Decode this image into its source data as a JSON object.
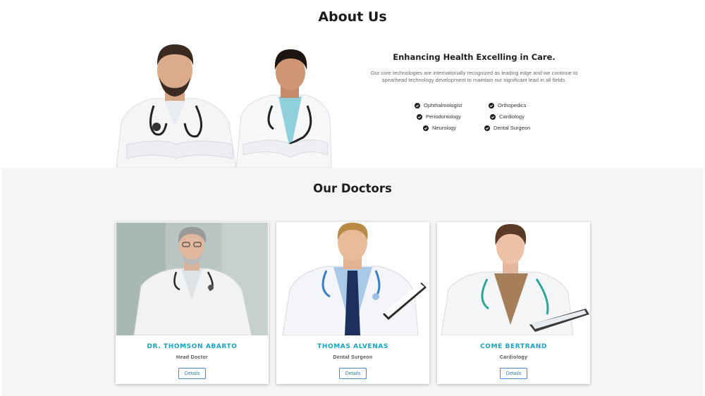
{
  "about": {
    "title": "About Us",
    "subtitle": "Enhancing Health Excelling in Care.",
    "description": "Our core technologies are internationally recognized as leading edge and we continue to spearhead technology development to maintain our significant lead in all fields.",
    "specialties": [
      "Ophthalmologist",
      "Orthopedics",
      "Periodontology",
      "Cardiology",
      "Neurology",
      "Dental Surgeon"
    ]
  },
  "doctors": {
    "title": "Our Doctors",
    "cards": [
      {
        "name": "DR. THOMSON ABARTO",
        "role": "Head Doctor",
        "button": "Details"
      },
      {
        "name": "THOMAS ALVENAS",
        "role": "Dental Surgeon",
        "button": "Details"
      },
      {
        "name": "COME BERTRAND",
        "role": "Cardiology",
        "button": "Details"
      }
    ]
  },
  "colors": {
    "accent_name": "#1aa3c0",
    "button_border": "#4a86d8",
    "section_bg": "#f5f5f5"
  }
}
